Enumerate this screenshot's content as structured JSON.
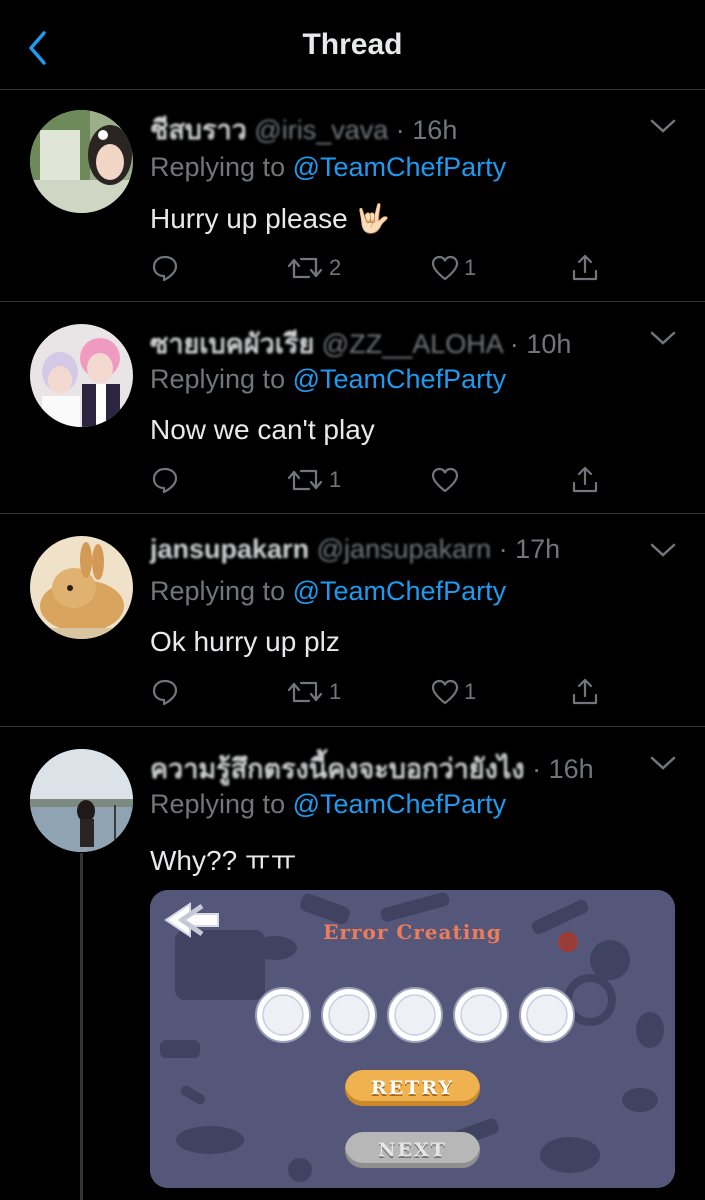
{
  "header": {
    "title": "Thread",
    "back_icon": "chevron-left-icon",
    "accent": "#1d9bf0"
  },
  "tweets": [
    {
      "display_name": "ชีสบราว",
      "handle": "@iris_vava",
      "time": "16h",
      "replying_prefix": "Replying to",
      "replying_to": "@TeamChefParty",
      "text": "Hurry up please 🤟🏻",
      "replies": "",
      "retweets": "2",
      "likes": "1"
    },
    {
      "display_name": "ซายเบคผัวเรีย",
      "handle": "@ZZ__ALOHA",
      "time": "10h",
      "replying_prefix": "Replying to",
      "replying_to": "@TeamChefParty",
      "text": "Now we can't play",
      "replies": "",
      "retweets": "1",
      "likes": ""
    },
    {
      "display_name": "jansupakarn",
      "handle": "@jansupakarn",
      "time": "17h",
      "replying_prefix": "Replying to",
      "replying_to": "@TeamChefParty",
      "text": "Ok hurry up plz",
      "replies": "",
      "retweets": "1",
      "likes": "1"
    },
    {
      "display_name": "ความรู้สึกตรงนี้คงจะบอกว่ายังไง",
      "handle": "",
      "time": "16h",
      "replying_prefix": "Replying to",
      "replying_to": "@TeamChefParty",
      "text": "Why?? ㅠㅠ",
      "media": {
        "title": "Error Creating",
        "retry_label": "RETRY",
        "next_label": "NEXT",
        "back_icon": "double-arrow-left-icon",
        "slot_count": 5
      }
    }
  ],
  "separator": "·",
  "colors": {
    "background": "#000000",
    "text": "#e7e9ea",
    "muted": "#71767b",
    "link": "#1d9bf0",
    "divider": "#2f3336"
  }
}
